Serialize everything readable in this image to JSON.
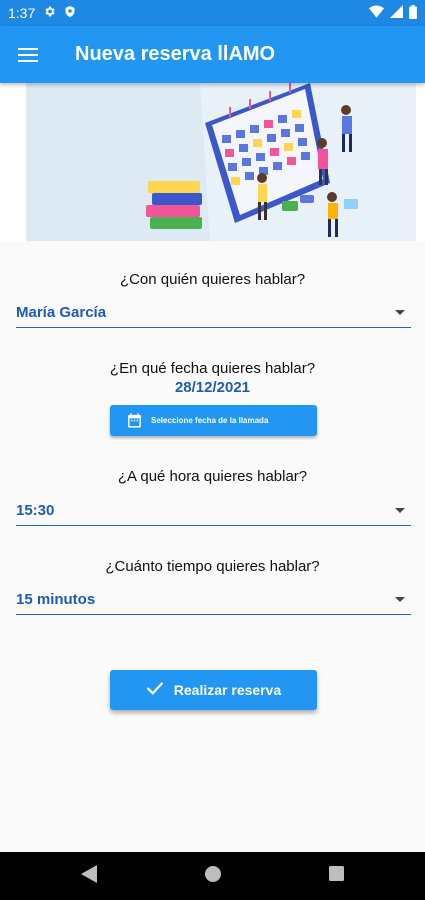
{
  "status_bar": {
    "time": "1:37",
    "icons": [
      "gear-icon",
      "shield-icon",
      "wifi-icon",
      "signal-icon",
      "battery-icon"
    ]
  },
  "app_bar": {
    "menu_icon": "hamburger-menu-icon",
    "title": "Nueva reserva llAMO"
  },
  "hero": {
    "image": "calendar-illustration"
  },
  "form": {
    "person": {
      "question": "¿Con quién quieres hablar?",
      "value": "María García"
    },
    "date": {
      "question": "¿En qué fecha quieres hablar?",
      "value": "28/12/2021",
      "button_label": "Seleccione fecha de la llamada",
      "button_icon": "calendar-icon"
    },
    "time": {
      "question": "¿A qué hora quieres hablar?",
      "value": "15:30"
    },
    "duration": {
      "question": "¿Cuánto tiempo quieres hablar?",
      "value": "15 minutos"
    },
    "submit": {
      "label": "Realizar reserva",
      "icon": "check-icon"
    }
  },
  "nav_bar": {
    "icons": [
      "back-icon",
      "home-icon",
      "recents-icon"
    ]
  },
  "colors": {
    "primary": "#2196f3",
    "status_bar": "#1e88e5",
    "value_text": "#1e5bb5",
    "underline": "#1e66c2"
  }
}
